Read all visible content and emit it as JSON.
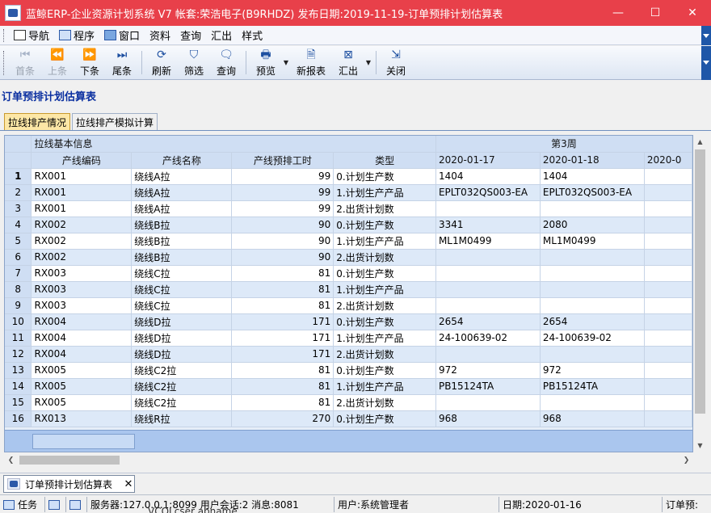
{
  "window": {
    "title": "蓝鲸ERP-企业资源计划系统 V7 帐套:荣浩电子(B9RHDZ) 发布日期:2019-11-19-订单预排计划估算表",
    "minimize_glyph": "—",
    "maximize_glyph": "☐",
    "close_glyph": "✕"
  },
  "menu": {
    "items": [
      {
        "label": "导航",
        "icon": "navigation-icon"
      },
      {
        "label": "程序",
        "icon": "program-icon"
      },
      {
        "label": "窗口",
        "icon": "window-icon"
      },
      {
        "label": "资料"
      },
      {
        "label": "查询"
      },
      {
        "label": "汇出"
      },
      {
        "label": "样式"
      }
    ]
  },
  "toolbar": {
    "first": "首条",
    "prev": "上条",
    "next": "下条",
    "last": "尾条",
    "refresh": "刷新",
    "filter": "筛选",
    "query": "查询",
    "preview": "预览",
    "new_report": "新报表",
    "export": "汇出",
    "close": "关闭"
  },
  "report": {
    "heading": "订单预排计划估算表",
    "tabs": [
      "拉线排产情况",
      "拉线排产模拟计算"
    ],
    "active_tab": 0
  },
  "grid": {
    "group_headers": {
      "basic": "拉线基本信息",
      "week": "第3周"
    },
    "columns": [
      "产线编码",
      "产线名称",
      "产线预排工时",
      "类型",
      "2020-01-17",
      "2020-01-18",
      "2020-0"
    ],
    "rows": [
      [
        "1",
        "RX001",
        "绕线A拉",
        "99",
        "0.计划生产数",
        "1404",
        "1404",
        ""
      ],
      [
        "2",
        "RX001",
        "绕线A拉",
        "99",
        "1.计划生产产品",
        "EPLT032QS003-EA",
        "EPLT032QS003-EA",
        ""
      ],
      [
        "3",
        "RX001",
        "绕线A拉",
        "99",
        "2.出货计划数",
        "",
        "",
        ""
      ],
      [
        "4",
        "RX002",
        "绕线B拉",
        "90",
        "0.计划生产数",
        "3341",
        "2080",
        ""
      ],
      [
        "5",
        "RX002",
        "绕线B拉",
        "90",
        "1.计划生产产品",
        "ML1M0499",
        "ML1M0499",
        ""
      ],
      [
        "6",
        "RX002",
        "绕线B拉",
        "90",
        "2.出货计划数",
        "",
        "",
        ""
      ],
      [
        "7",
        "RX003",
        "绕线C拉",
        "81",
        "0.计划生产数",
        "",
        "",
        ""
      ],
      [
        "8",
        "RX003",
        "绕线C拉",
        "81",
        "1.计划生产产品",
        "",
        "",
        ""
      ],
      [
        "9",
        "RX003",
        "绕线C拉",
        "81",
        "2.出货计划数",
        "",
        "",
        ""
      ],
      [
        "10",
        "RX004",
        "绕线D拉",
        "171",
        "0.计划生产数",
        "2654",
        "2654",
        ""
      ],
      [
        "11",
        "RX004",
        "绕线D拉",
        "171",
        "1.计划生产产品",
        "24-100639-02",
        "24-100639-02",
        ""
      ],
      [
        "12",
        "RX004",
        "绕线D拉",
        "171",
        "2.出货计划数",
        "",
        "",
        ""
      ],
      [
        "13",
        "RX005",
        "绕线C2拉",
        "81",
        "0.计划生产数",
        "972",
        "972",
        ""
      ],
      [
        "14",
        "RX005",
        "绕线C2拉",
        "81",
        "1.计划生产产品",
        "PB15124TA",
        "PB15124TA",
        ""
      ],
      [
        "15",
        "RX005",
        "绕线C2拉",
        "81",
        "2.出货计划数",
        "",
        "",
        ""
      ],
      [
        "16",
        "RX013",
        "绕线R拉",
        "270",
        "0.计划生产数",
        "968",
        "968",
        ""
      ]
    ]
  },
  "doc_tab": {
    "label": "订单预排计划估算表",
    "close_glyph": "✕"
  },
  "status": {
    "task": "任务",
    "server": "服务器:127.0.0.1:8099 用户会话:2 消息:8081",
    "user": "用户:系统管理者",
    "date": "日期:2020-01-16",
    "form": "订单预:",
    "overlap_text": "VCOLcser  abname"
  }
}
